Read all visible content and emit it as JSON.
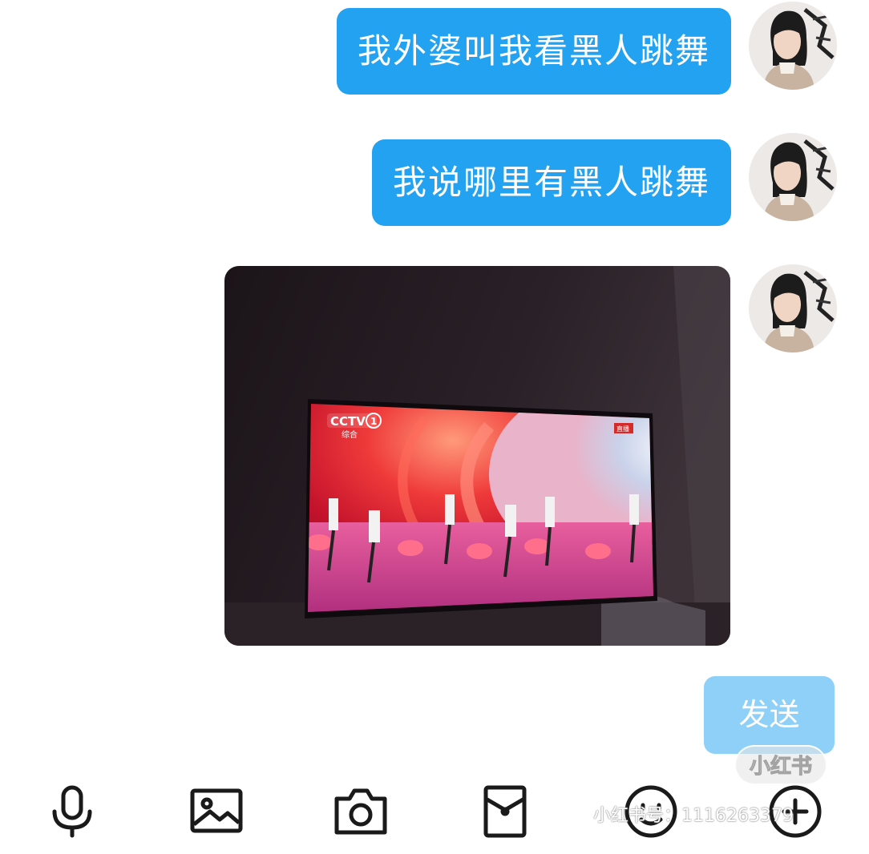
{
  "messages": [
    {
      "text": "我外婆叫我看黑人跳舞"
    },
    {
      "text": "我说哪里有黑人跳舞"
    }
  ],
  "photo": {
    "tv_logo": "CCTV",
    "tv_channel_number": "1",
    "tv_channel_name": "综合",
    "live_badge": "直播"
  },
  "input": {
    "send_label": "发送"
  },
  "toolbar": {
    "icons": [
      "microphone-icon",
      "image-icon",
      "camera-icon",
      "red-packet-icon",
      "emoji-icon",
      "plus-icon"
    ]
  },
  "watermark": {
    "logo": "小红书",
    "id_text": "小红书号：1116263379"
  },
  "colors": {
    "bubble": "#22a2f0",
    "send_button": "#8ed0f7",
    "background": "#ffffff"
  }
}
